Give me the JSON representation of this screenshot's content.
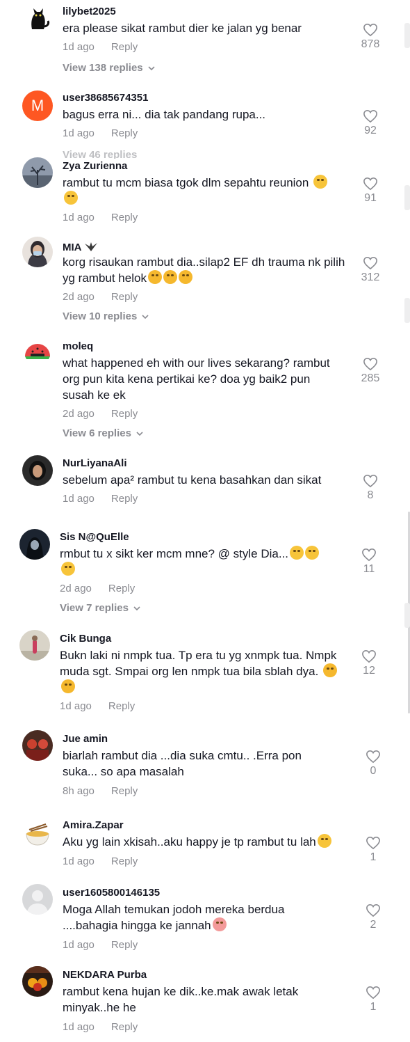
{
  "comments": [
    {
      "username": "lilybet2025",
      "text": "era please sikat rambut dier ke jalan yg benar",
      "time": "1d ago",
      "reply": "Reply",
      "likes": "878",
      "view_replies": "View 138 replies"
    },
    {
      "username": "user38685674351",
      "text": "bagus erra ni... dia tak pandang rupa...",
      "time": "1d ago",
      "reply": "Reply",
      "likes": "92",
      "view_replies": "View 46 replies",
      "avatar_letter": "M"
    },
    {
      "username": "Zya Zurienna",
      "text": "rambut tu mcm biasa tgok dlm sepahtu reunion",
      "time": "1d ago",
      "reply": "Reply",
      "likes": "91"
    },
    {
      "username": "MIA",
      "text": "korg risaukan rambut dia..silap2 EF dh trauma nk pilih yg rambut helok",
      "time": "2d ago",
      "reply": "Reply",
      "likes": "312",
      "view_replies": "View 10 replies"
    },
    {
      "username": "moleq",
      "text": "what happened eh with our lives sekarang? rambut org pun kita kena pertikai ke? doa yg baik2 pun susah ke ek",
      "time": "2d ago",
      "reply": "Reply",
      "likes": "285",
      "view_replies": "View 6 replies"
    },
    {
      "username": "NurLiyanaAli",
      "text": "sebelum apa² rambut tu kena basahkan dan sikat",
      "time": "1d ago",
      "reply": "Reply",
      "likes": "8"
    },
    {
      "username": "Sis N@QuElle",
      "text": "rmbut tu x sikt ker mcm mne? @ style Dia...",
      "time": "2d ago",
      "reply": "Reply",
      "likes": "11",
      "view_replies": "View 7 replies"
    },
    {
      "username": "Cik Bunga",
      "text": "Bukn laki ni nmpk tua. Tp era tu yg xnmpk tua. Nmpk muda sgt. Smpai org len nmpk tua bila sblah dya.",
      "time": "1d ago",
      "reply": "Reply",
      "likes": "12"
    },
    {
      "username": "Jue amin",
      "text": "biarlah rambut dia ...dia suka cmtu.. .Erra pon suka... so apa masalah",
      "time": "8h ago",
      "reply": "Reply",
      "likes": "0"
    },
    {
      "username": "Amira.Zapar",
      "text": "Aku yg lain xkisah..aku happy je tp rambut tu lah",
      "time": "1d ago",
      "reply": "Reply",
      "likes": "1"
    },
    {
      "username": "user1605800146135",
      "text": "Moga Allah temukan jodoh mereka berdua ....bahagia hingga ke jannah",
      "time": "1d ago",
      "reply": "Reply",
      "likes": "2"
    },
    {
      "username": "NEKDARA Purba",
      "text": "rambut kena hujan ke dik..ke.mak awak letak minyak..he he",
      "time": "1d ago",
      "reply": "Reply",
      "likes": "1"
    }
  ],
  "colors": {
    "text": "#161823",
    "muted": "#8a8b91",
    "avatar_orange": "#fe5722"
  },
  "icons": {
    "like": "heart-outline-icon",
    "expand": "chevron-down-icon"
  }
}
